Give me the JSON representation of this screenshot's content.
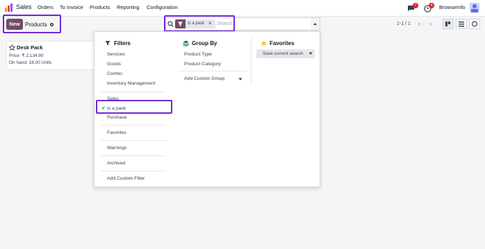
{
  "navbar": {
    "app_name": "Sales",
    "menu": [
      "Orders",
      "To Invoice",
      "Products",
      "Reporting",
      "Configuration"
    ],
    "chat_badge": "7",
    "activity_badge": "4",
    "company": "BrowseInfo"
  },
  "control": {
    "new_label": "New",
    "breadcrumb": "Products",
    "facet_label": "Is a pack",
    "search_placeholder": "Search...",
    "pager": "1-1 / 1"
  },
  "card": {
    "title": "Desk Pack",
    "price": "Price: ₹ 2,134.80",
    "on_hand": "On hand: 18.00 Units"
  },
  "filters": {
    "title": "Filters",
    "group1": [
      "Services",
      "Goods",
      "Combo",
      "Inventory Management"
    ],
    "group2": [
      "Sales",
      "Is a pack",
      "Purchase"
    ],
    "favorites": "Favorites",
    "warnings": "Warnings",
    "archived": "Archived",
    "add_custom": "Add Custom Filter"
  },
  "groupby": {
    "title": "Group By",
    "items": [
      "Product Type",
      "Product Category"
    ],
    "add_custom": "Add Custom Group"
  },
  "favorites": {
    "title": "Favorites",
    "save_label": "Save current search"
  },
  "colors": {
    "brand": "#714b67",
    "highlight": "#6d28d9"
  }
}
